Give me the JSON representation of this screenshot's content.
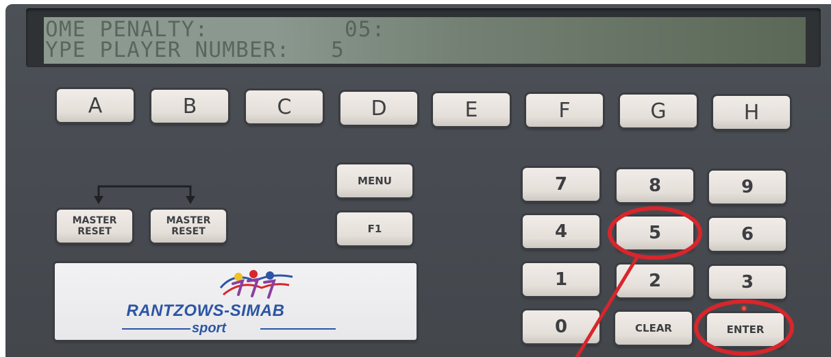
{
  "display": {
    "line1": "OME PENALTY:          05:",
    "line2": "YPE PLAYER NUMBER:   5"
  },
  "letter_keys": [
    "A",
    "B",
    "C",
    "D",
    "E",
    "F",
    "G",
    "H"
  ],
  "function_keys": {
    "menu": "MENU",
    "f1": "F1"
  },
  "master_reset": [
    {
      "line1": "MASTER",
      "line2": "RESET"
    },
    {
      "line1": "MASTER",
      "line2": "RESET"
    }
  ],
  "numpad": {
    "k7": "7",
    "k8": "8",
    "k9": "9",
    "k4": "4",
    "k5": "5",
    "k6": "6",
    "k1": "1",
    "k2": "2",
    "k3": "3",
    "k0": "0",
    "clear": "CLEAR",
    "enter": "ENTER"
  },
  "logo": {
    "name": "RANTZOWS-SIMAB",
    "sub": "sport"
  },
  "colors": {
    "panel": "#484c52",
    "key_face": "#e9e4df",
    "lcd": "#8a988f",
    "logo_blue": "#2d55a4",
    "annotation_red": "#d7262c"
  },
  "icons": [
    "swap-arrow-icon",
    "runners-logo-icon"
  ]
}
